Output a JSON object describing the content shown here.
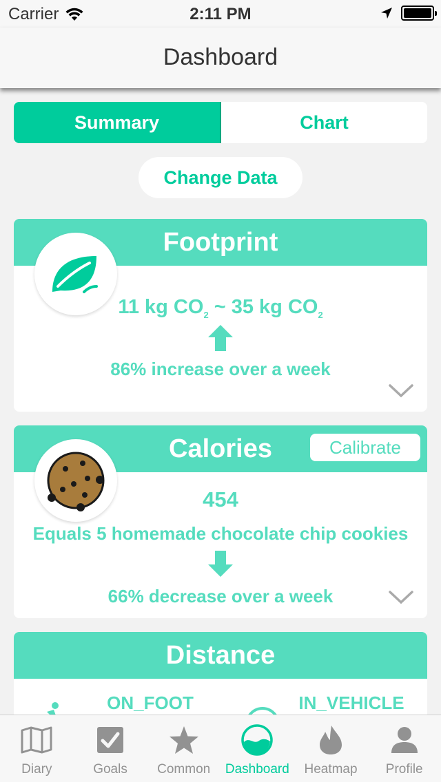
{
  "status_bar": {
    "carrier": "Carrier",
    "time": "2:11 PM"
  },
  "nav": {
    "title": "Dashboard"
  },
  "segments": {
    "summary": "Summary",
    "chart": "Chart"
  },
  "change_data_label": "Change Data",
  "footprint": {
    "title": "Footprint",
    "low_value": "11 kg CO",
    "high_value": "35 kg CO",
    "subscript": "2",
    "separator": "~",
    "change_text": "86% increase over a week"
  },
  "calories": {
    "title": "Calories",
    "calibrate_label": "Calibrate",
    "value": "454",
    "equivalent": "Equals 5 homemade chocolate chip cookies",
    "change_text": "66% decrease over a week"
  },
  "distance": {
    "title": "Distance",
    "mode_1": "ON_FOOT",
    "mode_2": "IN_VEHICLE"
  },
  "tabs": [
    {
      "label": "Diary",
      "icon": "map-icon"
    },
    {
      "label": "Goals",
      "icon": "checkbox-icon"
    },
    {
      "label": "Common",
      "icon": "star-icon"
    },
    {
      "label": "Dashboard",
      "icon": "dashboard-icon"
    },
    {
      "label": "Heatmap",
      "icon": "flame-icon"
    },
    {
      "label": "Profile",
      "icon": "person-icon"
    }
  ],
  "colors": {
    "accent": "#00cc9c",
    "card_header": "#55dcbe",
    "inactive_tab": "#929292"
  }
}
